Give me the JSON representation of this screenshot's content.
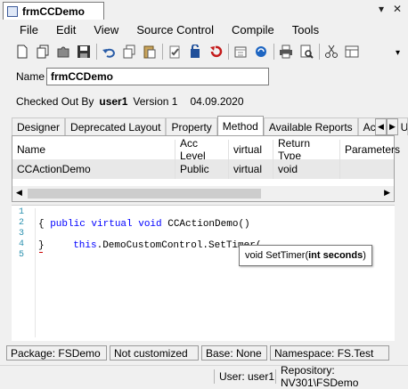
{
  "window": {
    "title": "frmCCDemo",
    "controls": {
      "pin": "▾",
      "close": "✕"
    }
  },
  "menu": [
    "File",
    "Edit",
    "View",
    "Source Control",
    "Compile",
    "Tools"
  ],
  "toolbar": {
    "icons": [
      "new-icon",
      "copy-doc-icon",
      "puzzle-icon",
      "save-icon",
      "undo-icon",
      "copy-icon",
      "paste-icon",
      "checkin-icon",
      "checkout-icon",
      "undo-checkout-icon",
      "calendar-icon",
      "refresh-icon",
      "print-icon",
      "print-preview-icon",
      "cut-icon",
      "layout-icon"
    ]
  },
  "name": {
    "label": "Name",
    "value": "frmCCDemo"
  },
  "checkout": {
    "label": "Checked Out By",
    "user": "user1",
    "version": "Version 1",
    "date": "04.09.2020"
  },
  "tabs": [
    {
      "label": "Designer",
      "active": false
    },
    {
      "label": "Deprecated Layout",
      "active": false
    },
    {
      "label": "Property",
      "active": false
    },
    {
      "label": "Method",
      "active": true
    },
    {
      "label": "Available Reports",
      "active": false
    },
    {
      "label": "Access Ur",
      "active": false
    }
  ],
  "grid": {
    "columns": [
      "Name",
      "Acc Level",
      "virtual",
      "Return Type",
      "Parameters"
    ],
    "rows": [
      [
        "CCActionDemo",
        "Public",
        "virtual",
        "void",
        ""
      ]
    ]
  },
  "code": {
    "line_numbers": [
      "1",
      "2",
      "3",
      "4",
      "5"
    ],
    "line1_kw": "public virtual void",
    "line1_rest": " CCActionDemo()",
    "line2": "{",
    "line3_kw": "this",
    "line3_rest": ".DemoCustomControl.SetTimer(",
    "line4": "}"
  },
  "tooltip": {
    "prefix": "void SetTimer(",
    "param": "int seconds",
    "suffix": ")"
  },
  "status": {
    "package": "Package: FSDemo",
    "customized": "Not customized",
    "base": "Base: None",
    "namespace": "Namespace: FS.Test"
  },
  "appstatus": {
    "user": "User: user1",
    "repository": "Repository: NV301\\FSDemo"
  },
  "colors": {
    "keyword": "#0000ff",
    "line_number": "#2b91af",
    "selected_row": "#e8e8e8"
  }
}
